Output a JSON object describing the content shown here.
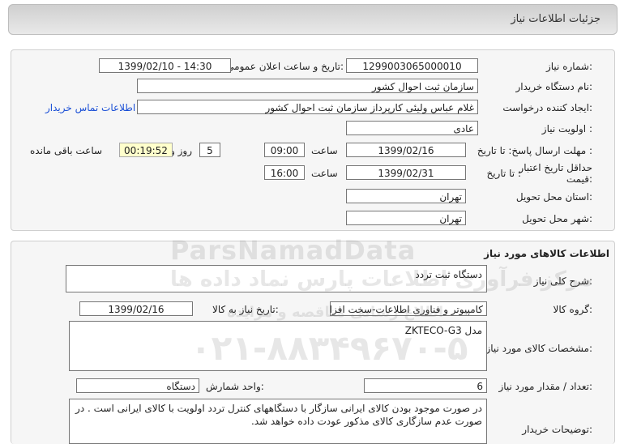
{
  "header": {
    "title": "جزئیات اطلاعات نیاز"
  },
  "info": {
    "need_no_label": "شماره نیاز:",
    "need_no": "1299003065000010",
    "announce_label": "تاریخ و ساعت اعلان عمومی:",
    "announce": "1399/02/10 - 14:30",
    "buyer_label": "نام دستگاه خریدار:",
    "buyer": "سازمان ثبت احوال کشور",
    "creator_label": "ایجاد کننده درخواست:",
    "creator": "غلام عباس ولیئی کارپرداز سازمان ثبت احوال کشور",
    "contact_link": "اطلاعات تماس خریدار",
    "priority_label": "اولویت نیاز :",
    "priority": "عادی",
    "deadline_label": "مهلت ارسال پاسخ:  تا تاریخ :",
    "deadline_date": "1399/02/16",
    "time_label": "ساعت",
    "deadline_time": "09:00",
    "days": "5",
    "days_label": "روز و",
    "remaining": "00:19:52",
    "remaining_label": "ساعت باقی مانده",
    "validity_label_1": "حداقل تاریخ اعتبار",
    "validity_label_2": "قیمت:",
    "validity_to_label": "تا تاریخ :",
    "validity_date": "1399/02/31",
    "validity_time_label": "ساعت",
    "validity_time": "16:00",
    "province_label": "استان محل تحویل:",
    "province": "تهران",
    "city_label": "شهر محل تحویل:",
    "city": "تهران"
  },
  "goods": {
    "title": "اطلاعات کالاهای مورد نیاز",
    "desc_label": "شرح کلی نیاز:",
    "desc": "دستگاه ثبت تردد",
    "group_label": "گروه کالا:",
    "group": "کامپیوتر و فناوری اطلاعات-سخت افزار",
    "need_date_label": "تاریخ نیاز به کالا:",
    "need_date": "1399/02/16",
    "specs_label": "مشخصات کالای مورد نیاز:",
    "specs": "مدل  ZKTECO-G3",
    "qty_label": "تعداد / مقدار مورد نیاز:",
    "qty": "6",
    "unit_label": "واحد شمارش:",
    "unit": "دستگاه",
    "notes_label": "توضیحات خریدار:",
    "notes": "در صورت موجود بودن کالای ایرانی سازگار با دستگاههای کنترل تردد اولویت با کالای ایرانی است . در صورت عدم سازگاری کالای مذکور عودت داده خواهد شد."
  },
  "watermark": {
    "brand": "ParsNamadData",
    "persian": "مرکز فرآوری اطلاعات پارس نماد داده ها",
    "phone": "۰۲۱-۸۸۳۴۹۶۷۰-۵",
    "sub": "اطلاع رسانی مناقصه و مزایده"
  }
}
